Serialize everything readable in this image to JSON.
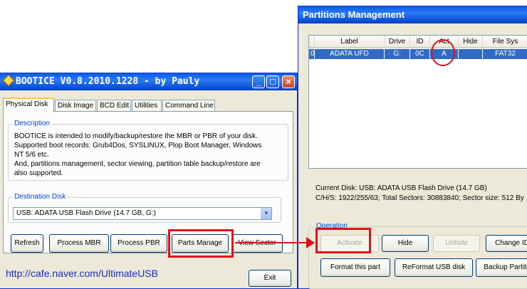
{
  "bootice": {
    "title": "BOOTICE V0.8.2010.1228 - by Pauly",
    "tabs": [
      "Physical Disk",
      "Disk Image",
      "BCD Edit",
      "Utilities",
      "Command Line"
    ],
    "description_title": "Description",
    "description_text": "BOOTICE is intended to modify/backup/restore the MBR or PBR of your disk.\nSupported boot records: Grub4Dos, SYSLINUX, Plop Boot Manager, Windows\nNT 5/6 etc.\nAnd, partitions management, sector viewing, partition table backup/restore are\nalso supported.",
    "destination_title": "Destination Disk",
    "destination_value": "USB: ADATA   USB Flash Drive (14.7 GB, G:)",
    "buttons": {
      "refresh": "Refresh",
      "process_mbr": "Process MBR",
      "process_pbr": "Process PBR",
      "parts_manage": "Parts Manage",
      "view_sector": "View Sector",
      "exit": "Exit"
    }
  },
  "watermark_url": "http://cafe.naver.com/UltimateUSB",
  "partitions": {
    "title": "Partitions Management",
    "columns": [
      "",
      "Label",
      "Drive",
      "ID",
      "Act",
      "Hide",
      "File Sys"
    ],
    "rows": [
      {
        "index": "0",
        "label": "ADATA UFD",
        "drive": "G:",
        "id": "0C",
        "act": "A",
        "hide": "",
        "fs": "FAT32"
      }
    ],
    "current_disk": "Current Disk:   USB: ADATA   USB Flash Drive (14.7 GB)",
    "chs_info": "C/H/S: 1922/255/63; Total Sectors: 30883840; Sector size: 512 By",
    "operation_title": "Operation",
    "buttons": {
      "activate": "Activate",
      "hide": "Hide",
      "unhide": "Unhide",
      "change_id": "Change ID",
      "format": "Format this part",
      "reformat": "ReFormat USB disk",
      "backup": "Backup Partitio"
    }
  },
  "colors": {
    "annotation": "#e0101a",
    "title_bar": "#0a5ee8",
    "selection": "#316ac5",
    "group_label": "#0046d5"
  }
}
